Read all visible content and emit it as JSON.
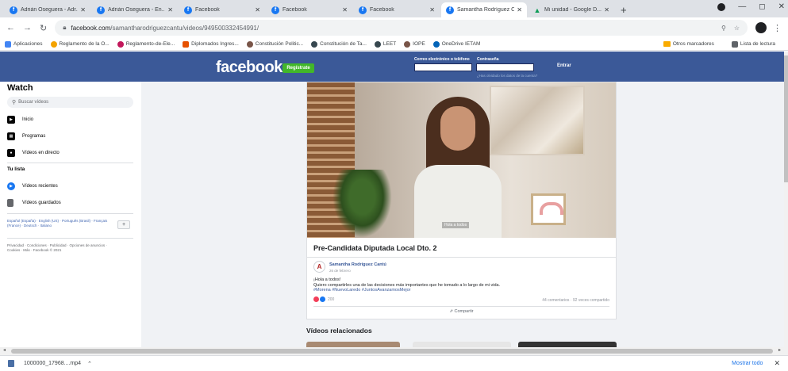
{
  "browser": {
    "tabs": [
      {
        "title": "Adrián Oseguera - Adr..."
      },
      {
        "title": "Adrián Oseguera - En..."
      },
      {
        "title": "Facebook"
      },
      {
        "title": "Facebook"
      },
      {
        "title": "Facebook"
      },
      {
        "title": "Samantha Rodríguez C..."
      },
      {
        "title": "Mi unidad - Google D..."
      }
    ],
    "new_tab": "+",
    "url_host": "facebook.com",
    "url_path": "/samantharodriguezcantu/videos/949500332454991/",
    "bookmarks": [
      "Aplicaciones",
      "Reglamento de la O...",
      "Reglamento-de-Ele...",
      "Diplomados Ingres...",
      "Constitución Politic...",
      "Constitución de Ta...",
      "LEET",
      "IOPE",
      "OneDrive IETAM"
    ],
    "bookmarks_right": [
      "Otros marcadores",
      "Lista de lectura"
    ]
  },
  "fb_header": {
    "logo": "facebook",
    "register": "Regístrate",
    "email_label": "Correo electrónico o teléfono",
    "password_label": "Contraseña",
    "forgot": "¿Has olvidado los datos de la cuenta?",
    "login": "Entrar"
  },
  "sidebar": {
    "title": "Watch",
    "search_placeholder": "Buscar vídeos",
    "items": [
      {
        "label": "Inicio"
      },
      {
        "label": "Programas"
      },
      {
        "label": "Vídeos en directo"
      }
    ],
    "list_title": "Tu lista",
    "list_items": [
      {
        "label": "Vídeos recientes"
      },
      {
        "label": "Vídeos guardados"
      }
    ],
    "languages": "Español (España) · English (US) · Português (Brasil) · Français (France) · Deutsch · Italiano",
    "legal": "Privacidad · Condiciones · Publicidad · Opciones de anuncios · Cookies · Más · Facebook © 2021"
  },
  "post": {
    "title": "Pre-Candidata Diputada Local Dto. 2",
    "author": "Samantha Rodríguez Cantú",
    "date": "26 de febrero",
    "line1": "¡Hola a todos!",
    "line2": "Quiero compartirles una de las decisiones más importantes que he tomado a lo largo de mi vida.",
    "tags": "#Morena #NuevoLaredo #JuntosAvanzamosMejor",
    "reactions": "200",
    "counts": "44 comentarios · 92 veces compartido",
    "share": "Compartir",
    "video_caption": "Hola a todos"
  },
  "related_title": "Vídeos relacionados",
  "download": {
    "file": "1000000_17968....mp4",
    "show_all": "Mostrar todo"
  }
}
